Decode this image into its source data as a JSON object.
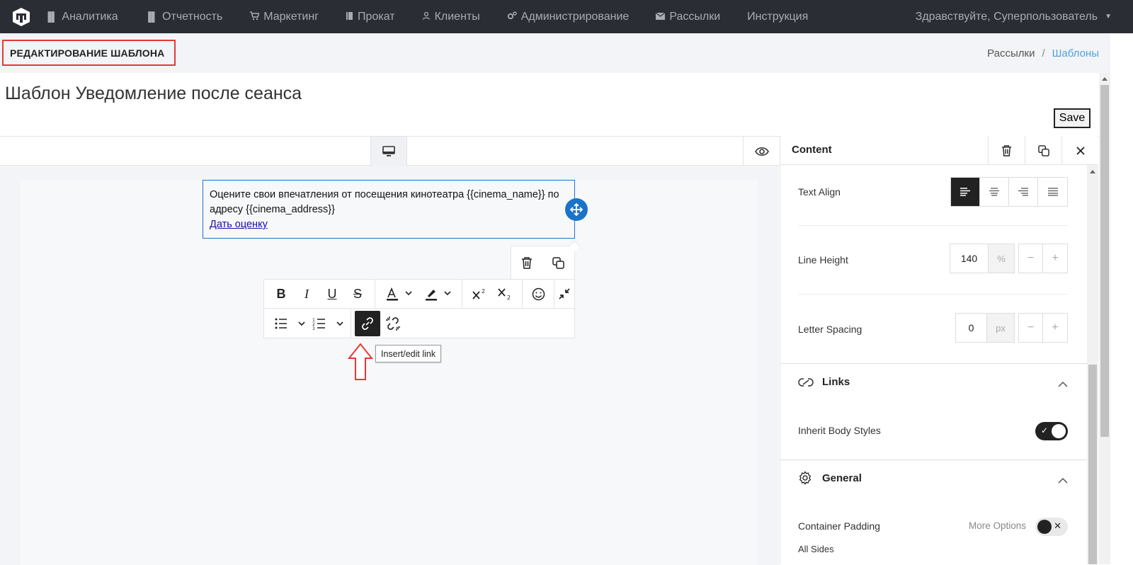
{
  "navbar": {
    "items": [
      {
        "label": "Аналитика",
        "icon": "bar-chart-icon"
      },
      {
        "label": "Отчетность",
        "icon": "bar-chart-icon"
      },
      {
        "label": "Маркетинг",
        "icon": "cart-icon"
      },
      {
        "label": "Прокат",
        "icon": "book-icon"
      },
      {
        "label": "Клиенты",
        "icon": "user-icon"
      },
      {
        "label": "Администрирование",
        "icon": "gears-icon"
      },
      {
        "label": "Рассылки",
        "icon": "envelope-icon"
      },
      {
        "label": "Инструкция",
        "icon": ""
      }
    ],
    "user_greeting": "Здравствуйте, Суперпользователь"
  },
  "page": {
    "heading": "РЕДАКТИРОВАНИЕ ШАБЛОНА",
    "breadcrumb": {
      "parent": "Рассылки",
      "current": "Шаблоны"
    },
    "template_title": "Шаблон Уведомление после сеанса",
    "save_label": "Save"
  },
  "canvas": {
    "text_line": "Оцените свои впечатления от посещения кинотеатра {{cinema_name}} по адресу {{cinema_address}}",
    "link_text": "Дать оценку",
    "tooltip": "Insert/edit link"
  },
  "panel": {
    "title": "Content",
    "text_align_label": "Text Align",
    "line_height_label": "Line Height",
    "line_height_value": "140",
    "line_height_unit": "%",
    "letter_spacing_label": "Letter Spacing",
    "letter_spacing_value": "0",
    "letter_spacing_unit": "px",
    "stepper_minus": "−",
    "stepper_plus": "+",
    "links_title": "Links",
    "inherit_label": "Inherit Body Styles",
    "general_title": "General",
    "container_padding_label": "Container Padding",
    "more_options": "More Options",
    "all_sides": "All Sides"
  },
  "colors": {
    "accent": "#1a73c9",
    "navbar": "#2b2d35",
    "highlight_border": "#e53935"
  }
}
